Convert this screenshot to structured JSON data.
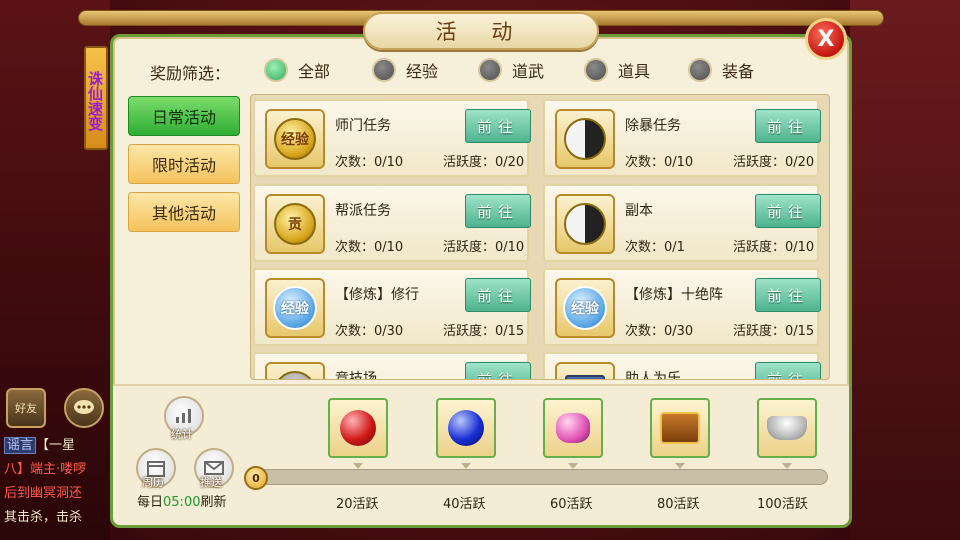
{
  "window": {
    "title": "活 动",
    "close_label": "X"
  },
  "side_banner": {
    "text": "诛仙速变"
  },
  "filter": {
    "label": "奖励筛选：",
    "options": [
      {
        "label": "全部",
        "selected": true
      },
      {
        "label": "经验",
        "selected": false
      },
      {
        "label": "道武",
        "selected": false
      },
      {
        "label": "道具",
        "selected": false
      },
      {
        "label": "装备",
        "selected": false
      }
    ]
  },
  "tabs": [
    {
      "label": "日常活动",
      "active": true
    },
    {
      "label": "限时活动",
      "active": false
    },
    {
      "label": "其他活动",
      "active": false
    }
  ],
  "activities": [
    {
      "name": "师门任务",
      "count": "次数：0/10",
      "activity": "活跃度：0/20",
      "button": "前往",
      "icon": "gold-coin-exp-icon"
    },
    {
      "name": "除暴任务",
      "count": "次数：0/10",
      "activity": "活跃度：0/20",
      "button": "前往",
      "icon": "taiji-exp-icon"
    },
    {
      "name": "帮派任务",
      "count": "次数：0/10",
      "activity": "活跃度：0/10",
      "button": "前往",
      "icon": "tribute-coin-icon"
    },
    {
      "name": "副本",
      "count": "次数：0/1",
      "activity": "活跃度：0/10",
      "button": "前往",
      "icon": "taiji-exp-icon"
    },
    {
      "name": "【修炼】修行",
      "count": "次数：0/30",
      "activity": "活跃度：0/15",
      "button": "前往",
      "icon": "exp-badge-icon"
    },
    {
      "name": "【修炼】十绝阵",
      "count": "次数：0/30",
      "activity": "活跃度：0/15",
      "button": "前往",
      "icon": "exp-badge-icon"
    },
    {
      "name": "竞技场",
      "count": "",
      "activity": "",
      "button": "前往",
      "icon": "arena-icon"
    },
    {
      "name": "助人为乐",
      "count": "",
      "activity": "",
      "button": "前往",
      "icon": "book-icon"
    }
  ],
  "tool_buttons": {
    "stats": "统计",
    "calendar": "周历",
    "push": "推送"
  },
  "reset": {
    "prefix": "每日",
    "time": "05:00",
    "suffix": "刷新"
  },
  "progress": {
    "current": "0",
    "fraction": 0.0,
    "milestones": [
      "20活跃",
      "40活跃",
      "60活跃",
      "80活跃",
      "100活跃"
    ],
    "rewards": [
      "red-orb-icon",
      "blue-orb-icon",
      "pink-gem-icon",
      "treasure-chest-icon",
      "silver-ingot-icon"
    ]
  },
  "hud": {
    "friends_label": "好友",
    "chat_lines": [
      {
        "tag": "谣言",
        "text": "【一星"
      },
      {
        "tag": "",
        "text": "八】端主·喽啰"
      },
      {
        "tag": "",
        "text": "后到幽冥洞还"
      },
      {
        "tag": "",
        "text": "其击杀，击杀"
      }
    ]
  },
  "colors": {
    "accent_green": "#4db38e",
    "active_tab": "#2fae33",
    "title_brown": "#6b3d12"
  }
}
